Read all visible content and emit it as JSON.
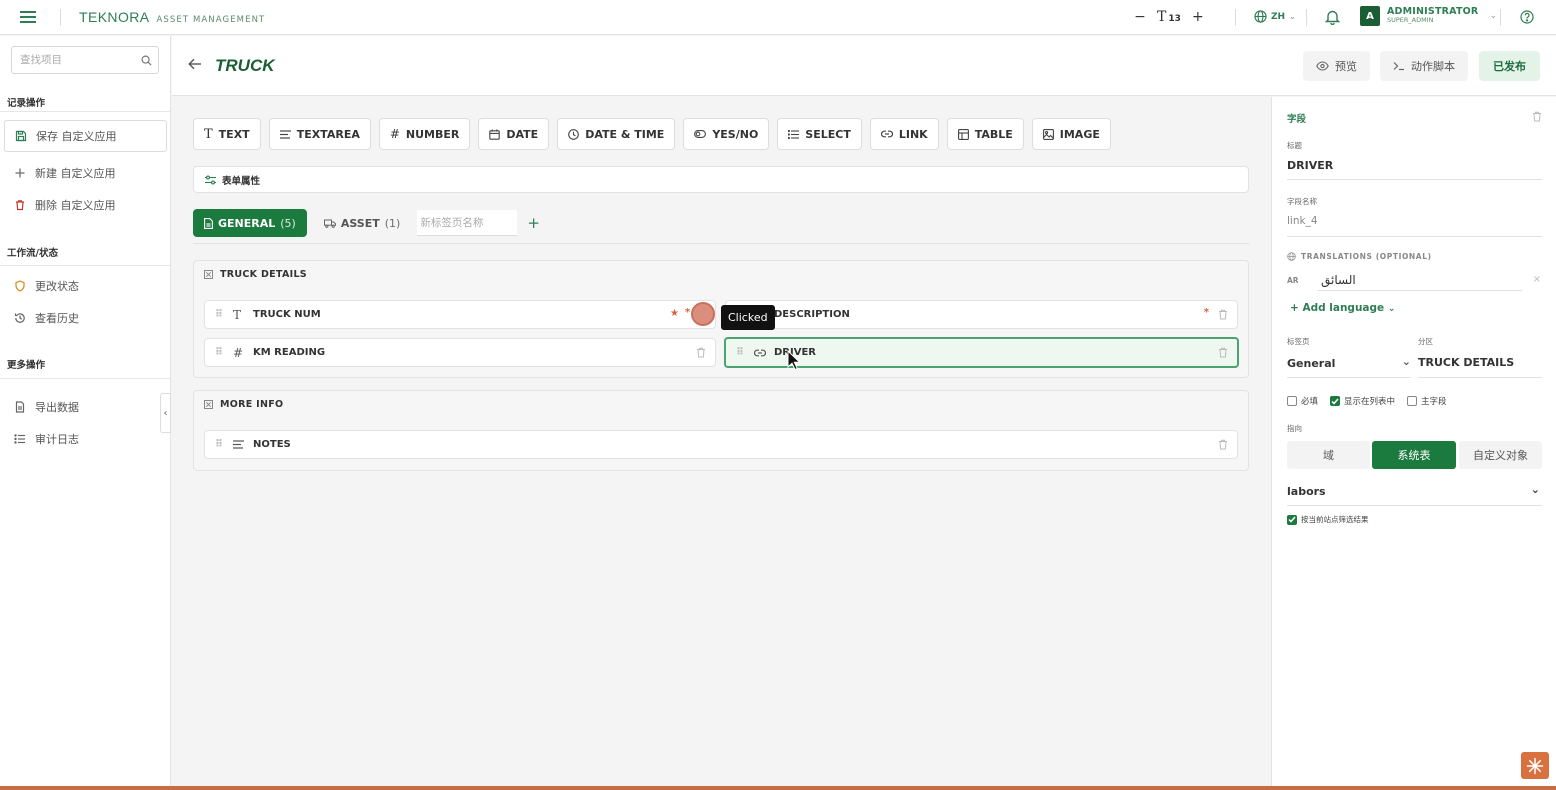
{
  "topbar": {
    "brand": "TEKNORA",
    "brand_sub": "ASSET MANAGEMENT",
    "font_size_label": "T",
    "font_size_value": "13",
    "lang": "ZH",
    "user_name": "ADMINISTRATOR",
    "user_role": "SUPER_ADMIN",
    "avatar_letter": "A"
  },
  "sidebar": {
    "search_placeholder": "查找项目",
    "sections": [
      {
        "title": "记录操作",
        "items": [
          {
            "label": "保存 自定义应用",
            "icon": "save-icon"
          },
          {
            "label": "新建 自定义应用",
            "icon": "plus-icon"
          },
          {
            "label": "删除 自定义应用",
            "icon": "trash-icon"
          }
        ]
      },
      {
        "title": "工作流/状态",
        "items": [
          {
            "label": "更改状态",
            "icon": "shield-icon"
          },
          {
            "label": "查看历史",
            "icon": "history-icon"
          }
        ]
      },
      {
        "title": "更多操作",
        "items": [
          {
            "label": "导出数据",
            "icon": "document-icon"
          },
          {
            "label": "审计日志",
            "icon": "list-icon"
          }
        ]
      }
    ]
  },
  "header": {
    "title": "TRUCK",
    "preview": "预览",
    "script": "动作脚本",
    "published": "已发布"
  },
  "toolbar": [
    "TEXT",
    "TEXTAREA",
    "NUMBER",
    "DATE",
    "DATE & TIME",
    "YES/NO",
    "SELECT",
    "LINK",
    "TABLE",
    "IMAGE"
  ],
  "form_props": "表单属性",
  "tabs": {
    "general_label": "GENERAL",
    "general_count": "(5)",
    "asset_label": "ASSET",
    "asset_count": "(1)",
    "new_tab_placeholder": "新标签页名称",
    "add": "+"
  },
  "sections": [
    {
      "title": "TRUCK DETAILS",
      "fields": [
        {
          "label": "TRUCK NUM",
          "type": "text",
          "required": "*"
        },
        {
          "label": "DESCRIPTION",
          "type": "text",
          "required": "*"
        },
        {
          "label": "KM READING",
          "type": "number"
        },
        {
          "label": "DRIVER",
          "type": "link"
        }
      ]
    },
    {
      "title": "MORE INFO",
      "fields": [
        {
          "label": "NOTES",
          "type": "textarea"
        }
      ]
    }
  ],
  "annotation": {
    "tooltip": "Clicked"
  },
  "right_panel": {
    "heading": "字段",
    "title_label": "标题",
    "title_value": "DRIVER",
    "fieldname_label": "字段名称",
    "fieldname_value": "link_4",
    "translations_label": "TRANSLATIONS (OPTIONAL)",
    "trans_lang": "AR",
    "trans_value": "السائق",
    "add_language": "+ Add language",
    "tab_label": "标签页",
    "tab_value": "General",
    "section_label": "分区",
    "section_value": "TRUCK DETAILS",
    "checkbox_required": "必填",
    "checkbox_in_list": "显示在列表中",
    "checkbox_primary": "主字段",
    "points_to_label": "指向",
    "seg_domain": "域",
    "seg_system": "系统表",
    "seg_custom": "自定义对象",
    "target_value": "labors",
    "filter_label": "按当前站点筛选结果"
  },
  "colors": {
    "brand": "#1b7a3e",
    "accent_light": "#e3f3e8",
    "annotation": "#d9826e"
  }
}
